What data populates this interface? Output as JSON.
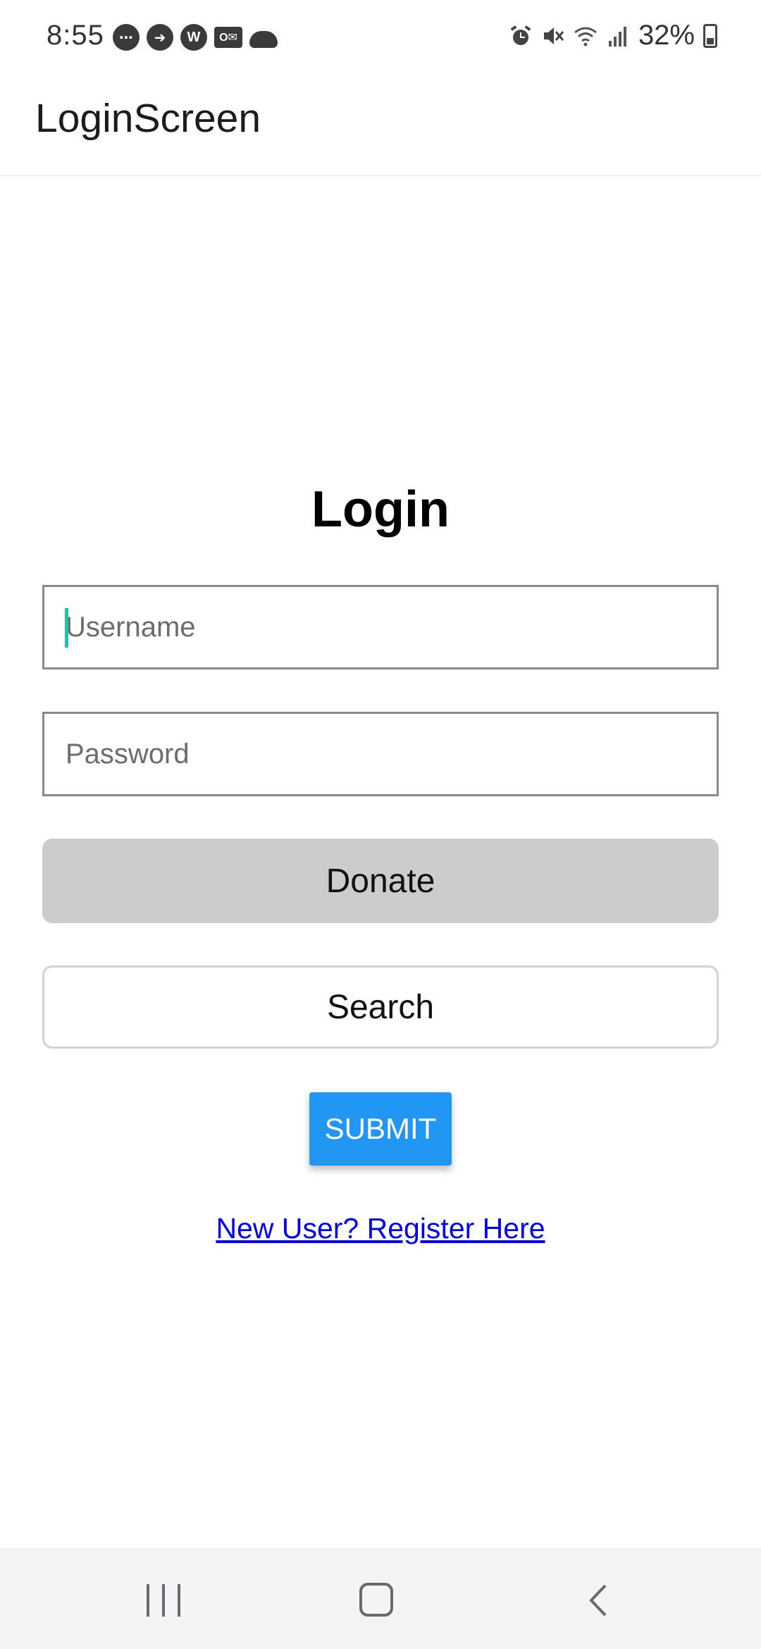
{
  "status_bar": {
    "time": "8:55",
    "notification_icons": [
      "chat-bubble-icon",
      "arrow-right-icon",
      "w-app-icon",
      "outlook-icon",
      "cloud-icon"
    ],
    "system_icons": [
      "alarm-icon",
      "mute-icon",
      "wifi-icon",
      "signal-icon"
    ],
    "battery_text": "32%"
  },
  "app_bar": {
    "title": "LoginScreen"
  },
  "login": {
    "heading": "Login",
    "username_placeholder": "Username",
    "password_placeholder": "Password",
    "donate_label": "Donate",
    "search_label": "Search",
    "submit_label": "SUBMIT",
    "register_link": "New User? Register Here"
  },
  "colors": {
    "submit_bg": "#2196f3",
    "donate_bg": "#cccccc",
    "link": "#0000ee",
    "caret": "#1ac6a8"
  }
}
